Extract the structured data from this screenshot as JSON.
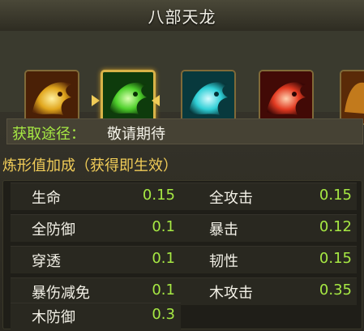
{
  "window": {
    "title": "八部天龙"
  },
  "icons": [
    {
      "name": "gold-dragon-icon",
      "color": "#e0a51c",
      "selected": false
    },
    {
      "name": "green-dragon-icon",
      "color": "#4fd02c",
      "selected": true
    },
    {
      "name": "cyan-dragon-icon",
      "color": "#2fcfd6",
      "selected": false
    },
    {
      "name": "red-dragon-icon",
      "color": "#e23a21",
      "selected": false
    }
  ],
  "source": {
    "label": "获取途径：",
    "value": "敬请期待"
  },
  "bonus_title": "炼形值加成（获得即生效）",
  "stats": [
    {
      "label": "生命",
      "value": "0.15"
    },
    {
      "label": "全攻击",
      "value": "0.15"
    },
    {
      "label": "全防御",
      "value": "0.1"
    },
    {
      "label": "暴击",
      "value": "0.12"
    },
    {
      "label": "穿透",
      "value": "0.1"
    },
    {
      "label": "韧性",
      "value": "0.15"
    },
    {
      "label": "暴伤减免",
      "value": "0.1"
    },
    {
      "label": "木攻击",
      "value": "0.35"
    },
    {
      "label": "木防御",
      "value": "0.3"
    }
  ]
}
